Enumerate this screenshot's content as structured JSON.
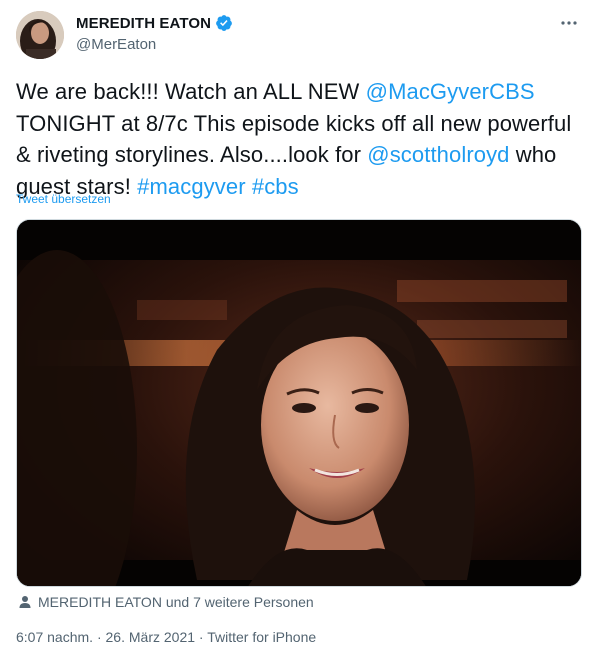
{
  "author": {
    "display_name": "MEREDITH EATON",
    "handle": "@MerEaton",
    "verified": true,
    "avatar": "profile-photo"
  },
  "tweet": {
    "segments": [
      {
        "text": "We are back!!! Watch an ALL NEW  ",
        "link": false
      },
      {
        "text": "@MacGyverCBS",
        "link": true
      },
      {
        "text": " TONIGHT at 8/7c This episode kicks off all new powerful & riveting storylines. Also....look for ",
        "link": false
      },
      {
        "text": "@scottholroyd",
        "link": true
      },
      {
        "text": " who guest stars! ",
        "link": false
      },
      {
        "text": "#macgyver",
        "link": true
      },
      {
        "text": " ",
        "link": false
      },
      {
        "text": "#cbs",
        "link": true
      }
    ],
    "translate_label": "Tweet übersetzen"
  },
  "media": {
    "description_icon": "video-still-woman-smiling"
  },
  "tagged": {
    "label": "MEREDITH EATON und 7 weitere Personen",
    "icon": "person-icon"
  },
  "meta": {
    "time": "6:07 nachm.",
    "separator": " · ",
    "date": "26. März 2021",
    "source": "Twitter for iPhone"
  },
  "colors": {
    "link": "#1d9bf0",
    "secondary": "#536471",
    "text": "#0f1419",
    "verified": "#1d9bf0"
  }
}
